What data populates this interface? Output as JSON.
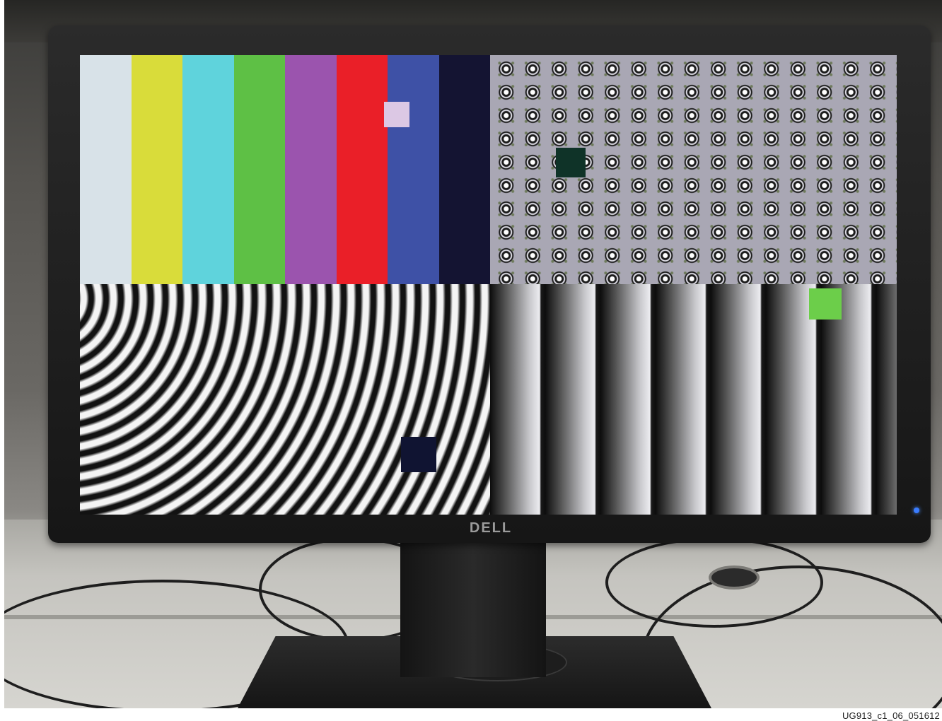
{
  "monitor": {
    "brand_logo": "DELL",
    "test_patterns": [
      {
        "id": "color-bars",
        "bars": [
          "#d8e2e8",
          "#d9dc3a",
          "#5fd3dc",
          "#5ec045",
          "#9b54ae",
          "#ea1f28",
          "#3e51a6",
          "#141432"
        ],
        "overlay_square_color": "#dcc8e4"
      },
      {
        "id": "zone-plate-dots",
        "overlay_square_color": "#0f3328"
      },
      {
        "id": "concentric-rings",
        "overlay_square_color": "#101432"
      },
      {
        "id": "vertical-gradient-bars",
        "overlay_square_color": "#6cce4a"
      }
    ],
    "power_led_color": "#3a7cff"
  },
  "caption": "UG913_c1_06_051612"
}
